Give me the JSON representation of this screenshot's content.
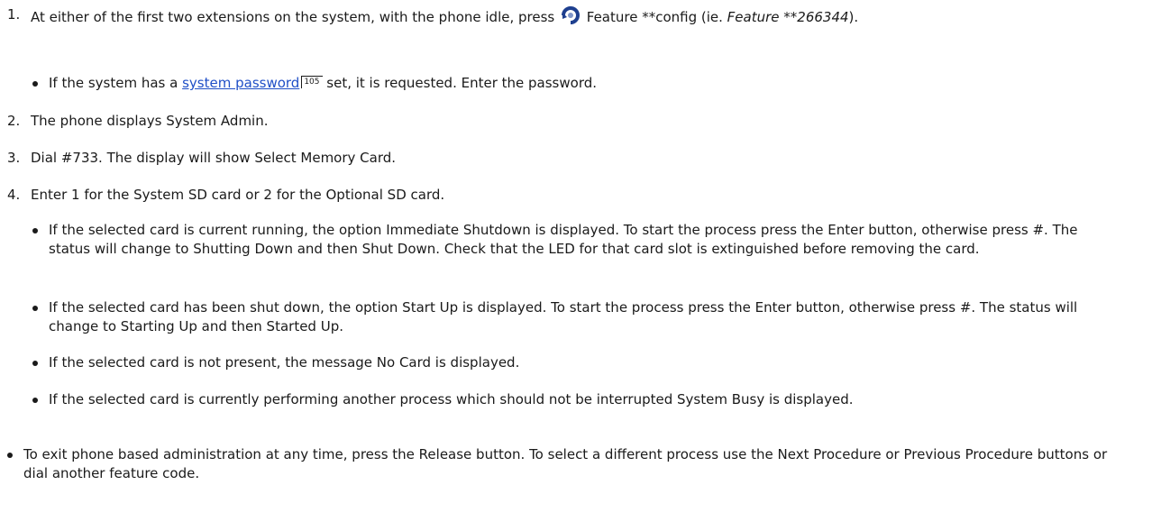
{
  "steps": [
    {
      "num": "1.",
      "pre": "At either of the first two extensions on the system, with the phone idle, press",
      "icon": "feature-button-icon",
      "post": " Feature **config (ie. ",
      "example": "Feature **266344",
      "end": ")."
    },
    {
      "num": "2.",
      "text": "The phone displays System Admin."
    },
    {
      "num": "3.",
      "text": "Dial #733. The display will show Select Memory Card."
    },
    {
      "num": "4.",
      "text": "Enter 1 for the System SD card or 2 for the Optional SD card."
    }
  ],
  "password_bullet": {
    "pre": "If the system has a ",
    "link": "system password",
    "xref": "105",
    "post": " set, it is requested. Enter the password."
  },
  "card_bullets": [
    "If the selected card is current running, the option Immediate Shutdown is displayed. To start the process press the Enter button, otherwise press #. The status will change to Shutting Down and then Shut Down. Check that the LED for that card slot is extinguished before removing the card.",
    "If the selected card has been shut down, the option Start Up is displayed. To start the process press the Enter button, otherwise press #. The status will change to Starting Up and then Started Up.",
    "If the selected card is not present, the message No Card is displayed.",
    "If the selected card is currently performing another process which should not be interrupted System Busy is displayed."
  ],
  "exit_bullet": "To exit phone based administration at any time, press the Release button. To select a different process use the Next Procedure or Previous Procedure buttons or dial another feature code.",
  "colors": {
    "text": "#1a1a1a",
    "link": "#1f4fc7",
    "icon_blue": "#1e3f8f"
  }
}
